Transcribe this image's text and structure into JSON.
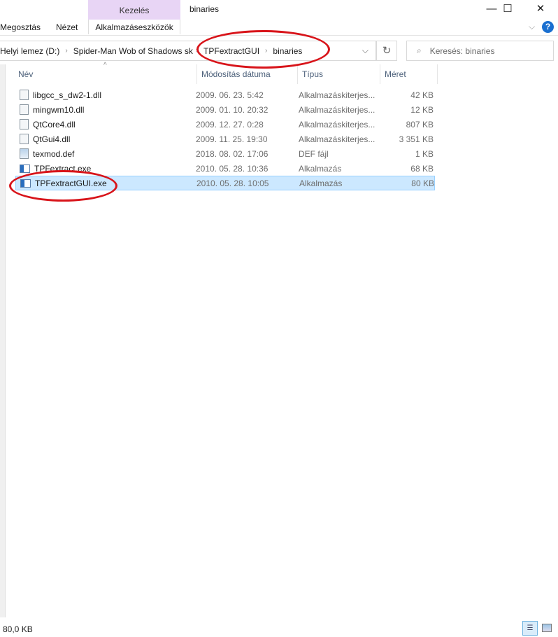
{
  "window": {
    "title": "binaries",
    "context_tab": "Kezelés",
    "minimize": "—",
    "maximize": "☐",
    "close": "✕"
  },
  "ribbon": {
    "tabs": [
      "Megosztás",
      "Nézet",
      "Alkalmazáseszközök"
    ],
    "collapse": "⌵",
    "help": "?"
  },
  "address": {
    "crumbs": [
      "Helyi lemez (D:)",
      "Spider-Man Wob of Shadows skin",
      "TPFextractGUI",
      "binaries"
    ],
    "separator": "›",
    "dropdown": "⌵",
    "refresh": "↻"
  },
  "search": {
    "placeholder": "Keresés: binaries",
    "icon": "⌕"
  },
  "columns": {
    "name": "Név",
    "date": "Módosítás dátuma",
    "type": "Típus",
    "size": "Méret",
    "sort": "^"
  },
  "files": [
    {
      "name": "libgcc_s_dw2-1.dll",
      "date": "2009. 06. 23. 5:42",
      "type": "Alkalmazáskiterjes...",
      "size": "42 KB",
      "icon": "dll"
    },
    {
      "name": "mingwm10.dll",
      "date": "2009. 01. 10. 20:32",
      "type": "Alkalmazáskiterjes...",
      "size": "12 KB",
      "icon": "dll"
    },
    {
      "name": "QtCore4.dll",
      "date": "2009. 12. 27. 0:28",
      "type": "Alkalmazáskiterjes...",
      "size": "807 KB",
      "icon": "dll"
    },
    {
      "name": "QtGui4.dll",
      "date": "2009. 11. 25. 19:30",
      "type": "Alkalmazáskiterjes...",
      "size": "3 351 KB",
      "icon": "dll"
    },
    {
      "name": "texmod.def",
      "date": "2018. 08. 02. 17:06",
      "type": "DEF fájl",
      "size": "1 KB",
      "icon": "def"
    },
    {
      "name": "TPFextract.exe",
      "date": "2010. 05. 28. 10:36",
      "type": "Alkalmazás",
      "size": "68 KB",
      "icon": "exe"
    },
    {
      "name": "TPFextractGUI.exe",
      "date": "2010. 05. 28. 10:05",
      "type": "Alkalmazás",
      "size": "80 KB",
      "icon": "exe",
      "selected": true
    }
  ],
  "status": {
    "selection_size": "80,0 KB"
  },
  "colors": {
    "selection": "#cce8ff",
    "annotation": "#d8141a",
    "context_tab": "#e8d5f5"
  }
}
